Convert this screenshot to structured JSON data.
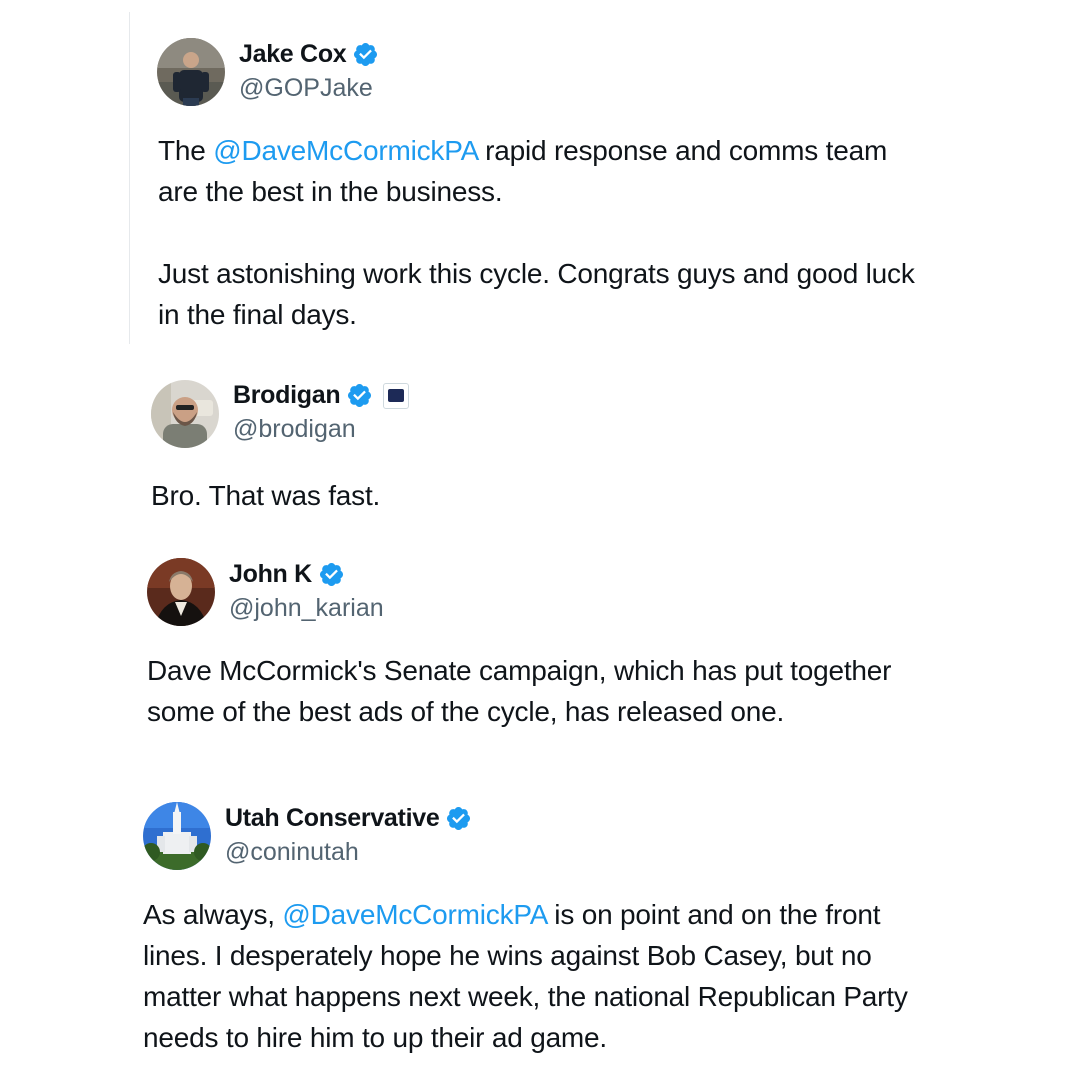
{
  "tweets": [
    {
      "name": "Jake Cox",
      "handle": "@GOPJake",
      "avatar_icon": "profile-photo-man-icon",
      "paragraphs": [
        {
          "before": "The ",
          "mention": "@DaveMcCormickPA",
          "after": " rapid response and comms team are the best in the business."
        },
        {
          "text": "Just astonishing work this cycle. Congrats guys and good luck in the final days."
        }
      ]
    },
    {
      "name": "Brodigan",
      "handle": "@brodigan",
      "avatar_icon": "profile-photo-bearded-man-icon",
      "affiliation_icon": "affiliation-badge-icon",
      "text": "Bro. That was fast."
    },
    {
      "name": "John K",
      "handle": "@john_karian",
      "avatar_icon": "profile-photo-portrait-painting-icon",
      "text": "Dave McCormick's Senate campaign, which has put together some of the best ads of the cycle, has released one."
    },
    {
      "name": "Utah Conservative",
      "handle": "@coninutah",
      "avatar_icon": "profile-photo-temple-icon",
      "before": "As always, ",
      "mention": "@DaveMcCormickPA",
      "after": " is on point and on the front lines. I desperately hope he wins against Bob Casey, but no matter what happens next week, the national Republican Party needs to hire him to up their ad game."
    }
  ],
  "colors": {
    "verified": "#1d9bf0",
    "mention": "#1d9bf0",
    "handle": "#536471",
    "text": "#0f1419"
  }
}
